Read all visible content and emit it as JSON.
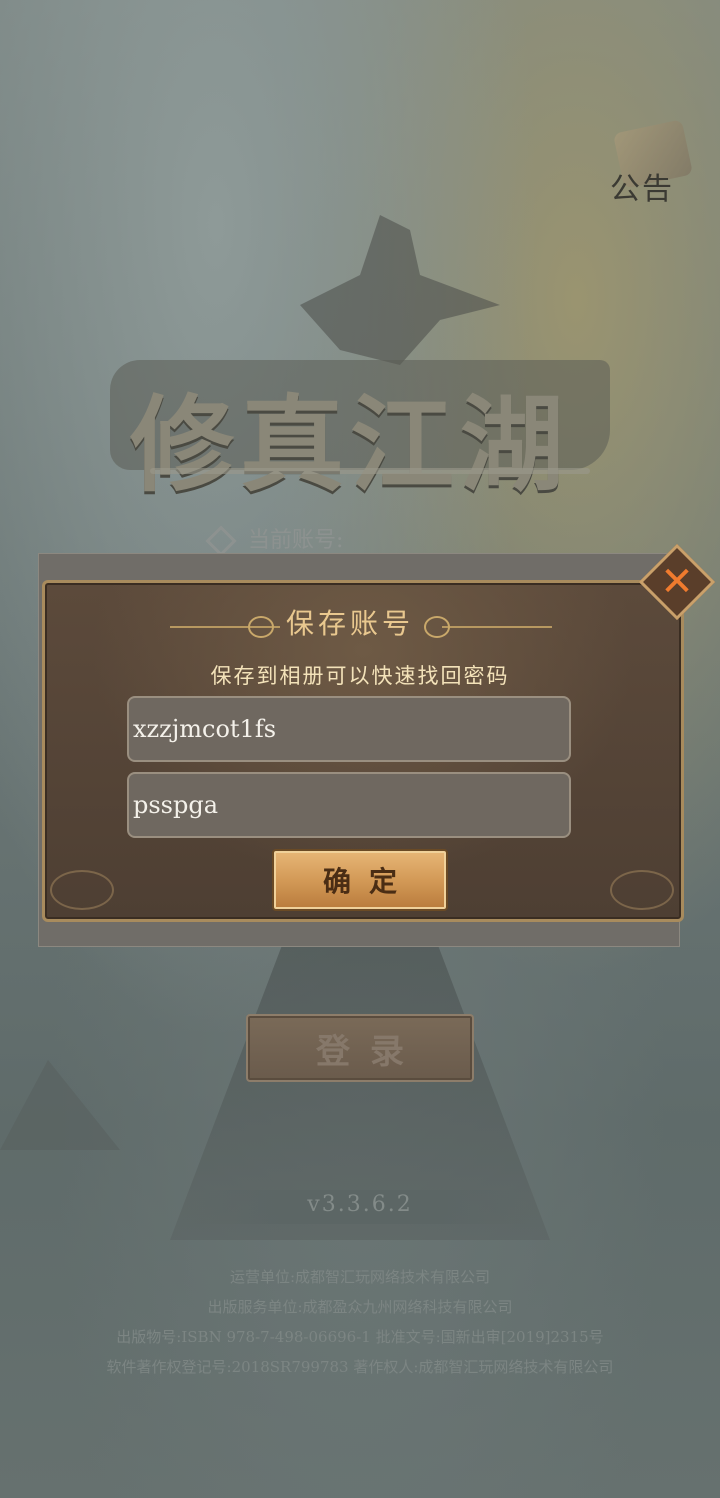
{
  "notice": {
    "label": "公告"
  },
  "logo": {
    "title": "修真江湖"
  },
  "account_label": "当前账号:",
  "dialog": {
    "title": "保存账号",
    "subtitle": "保存到相册可以快速找回密码",
    "account_value": "xzzjmcot1fs",
    "password_value": "psspga",
    "confirm_label": "确定",
    "close_symbol": "✕"
  },
  "login_label": "登录",
  "version": "v3.3.6.2",
  "footer": {
    "line1": "运营单位:成都智汇玩网络技术有限公司",
    "line2": "出版服务单位:成都盈众九州网络科技有限公司",
    "line3": "出版物号:ISBN 978-7-498-06696-1 批准文号:国新出审[2019]2315号",
    "line4": "软件著作权登记号:2018SR799783  著作权人:成都智汇玩网络技术有限公司"
  },
  "colors": {
    "accent_gold": "#e9c88f",
    "close_orange": "#f07b2e",
    "dialog_brown": "#5c4a3b"
  },
  "icons": [
    "notice-scroll-icon",
    "close-icon",
    "diamond-icon"
  ]
}
